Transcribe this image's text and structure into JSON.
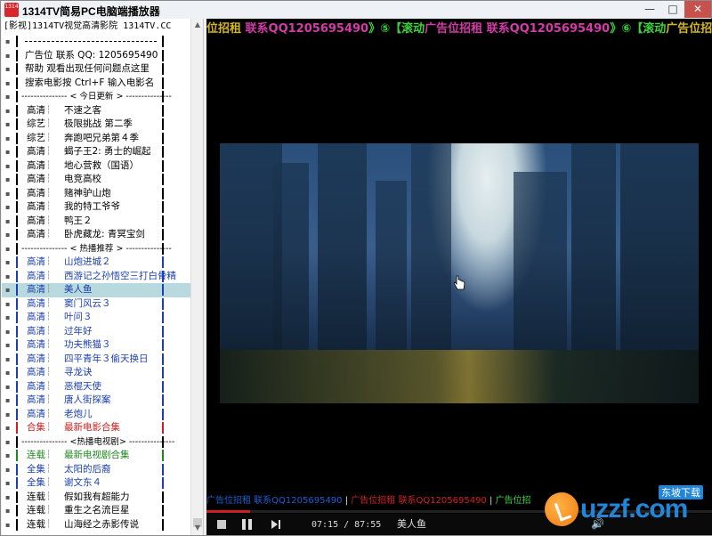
{
  "window": {
    "app_icon_text": "1314",
    "title": "1314TV简易PC电脑端播放器",
    "min": "—",
    "max": "□",
    "close": "✕"
  },
  "sidebar": {
    "site_line": "[影视]1314TV视觉高清影院 1314TV.CC",
    "items": [
      {
        "kind": "dash"
      },
      {
        "kind": "text",
        "text": "广告位 联系 QQ: 1205695490",
        "color": "#000"
      },
      {
        "kind": "text",
        "text": "帮助  观看出现任何问题点这里",
        "color": "#000"
      },
      {
        "kind": "text",
        "text": "搜索电影按 Ctrl+F 输入电影名",
        "color": "#000"
      },
      {
        "kind": "header",
        "text": "--------------- < 今日更新 > ---------------"
      },
      {
        "kind": "movie",
        "cat": "高清",
        "name": "不速之客",
        "color": "#000"
      },
      {
        "kind": "movie",
        "cat": "综艺",
        "name": "极限挑战 第二季",
        "color": "#000"
      },
      {
        "kind": "movie",
        "cat": "综艺",
        "name": "奔跑吧兄弟第４季",
        "color": "#000"
      },
      {
        "kind": "movie",
        "cat": "高清",
        "name": "蝎子王2: 勇士的崛起",
        "color": "#000"
      },
      {
        "kind": "movie",
        "cat": "高清",
        "name": "地心营救（国语）",
        "color": "#000"
      },
      {
        "kind": "movie",
        "cat": "高清",
        "name": "电竞高校",
        "color": "#000"
      },
      {
        "kind": "movie",
        "cat": "高清",
        "name": "赌神驴山炮",
        "color": "#000"
      },
      {
        "kind": "movie",
        "cat": "高清",
        "name": "我的特工爷爷",
        "color": "#000"
      },
      {
        "kind": "movie",
        "cat": "高清",
        "name": "鸭王２",
        "color": "#000"
      },
      {
        "kind": "movie",
        "cat": "高清",
        "name": "卧虎藏龙: 青冥宝剑",
        "color": "#000"
      },
      {
        "kind": "header",
        "text": "--------------- < 热播推荐 > ---------------"
      },
      {
        "kind": "movie",
        "cat": "高清",
        "name": "山炮进城２",
        "color": "#1a3fb0"
      },
      {
        "kind": "movie",
        "cat": "高清",
        "name": "西游记之孙悟空三打白骨精",
        "color": "#1a3fb0"
      },
      {
        "kind": "movie",
        "cat": "高清",
        "name": "美人鱼",
        "color": "#1a3fb0",
        "selected": true
      },
      {
        "kind": "movie",
        "cat": "高清",
        "name": "窦门风云３",
        "color": "#1a3fb0"
      },
      {
        "kind": "movie",
        "cat": "高清",
        "name": "叶问３",
        "color": "#1a3fb0"
      },
      {
        "kind": "movie",
        "cat": "高清",
        "name": "过年好",
        "color": "#1a3fb0"
      },
      {
        "kind": "movie",
        "cat": "高清",
        "name": "功夫熊猫３",
        "color": "#1a3fb0"
      },
      {
        "kind": "movie",
        "cat": "高清",
        "name": "四平青年３偷天换日",
        "color": "#1a3fb0"
      },
      {
        "kind": "movie",
        "cat": "高清",
        "name": "寻龙诀",
        "color": "#1a3fb0"
      },
      {
        "kind": "movie",
        "cat": "高清",
        "name": "恶棍天使",
        "color": "#1a3fb0"
      },
      {
        "kind": "movie",
        "cat": "高清",
        "name": "唐人街探案",
        "color": "#1a3fb0"
      },
      {
        "kind": "movie",
        "cat": "高清",
        "name": "老炮儿",
        "color": "#1a3fb0"
      },
      {
        "kind": "movie",
        "cat": "合集",
        "name": "最新电影合集",
        "color": "#cc2020"
      },
      {
        "kind": "header",
        "text": "--------------- <热播电视剧> ---------------"
      },
      {
        "kind": "movie",
        "cat": "连载",
        "name": "最新电视剧合集",
        "color": "#1c8a1c"
      },
      {
        "kind": "movie",
        "cat": "全集",
        "name": "太阳的后裔",
        "color": "#1a3fb0"
      },
      {
        "kind": "movie",
        "cat": "全集",
        "name": "谢文东４",
        "color": "#1a3fb0"
      },
      {
        "kind": "movie",
        "cat": "连载",
        "name": "假如我有超能力",
        "color": "#000"
      },
      {
        "kind": "movie",
        "cat": "连载",
        "name": "重生之名流巨星",
        "color": "#000"
      },
      {
        "kind": "movie",
        "cat": "连载",
        "name": "山海经之赤影传说",
        "color": "#000"
      }
    ]
  },
  "player": {
    "marquee_top": [
      {
        "text": "位招租 ",
        "color": "#d4b81a"
      },
      {
        "text": "联系QQ1205695490",
        "color": "#d43aa8"
      },
      {
        "text": "》⑤【滚动",
        "color": "#3cd43c"
      },
      {
        "text": "广告位招租 ",
        "color": "#d43aa8"
      },
      {
        "text": "联系QQ1205695490",
        "color": "#d43aa8"
      },
      {
        "text": "》⑥【滚动",
        "color": "#3cd43c"
      },
      {
        "text": "广告位招租",
        "color": "#d4b81a"
      }
    ],
    "marquee_bottom": [
      {
        "text": "广告位招租 联系QQ1205695490",
        "color": "#1a5fd4"
      },
      {
        "text": " | ",
        "color": "#ddd"
      },
      {
        "text": "广告位招租 联系QQ1205695490",
        "color": "#d42020"
      },
      {
        "text": " | ",
        "color": "#ddd"
      },
      {
        "text": "广告位招",
        "color": "#3cd43c"
      }
    ],
    "progress": 0.086,
    "time": "07:15 / 87:55",
    "now_playing": "美人鱼",
    "volume_icon": "🔊"
  },
  "watermark": {
    "brand": "uzzf.com",
    "sub": "东坡下载"
  }
}
